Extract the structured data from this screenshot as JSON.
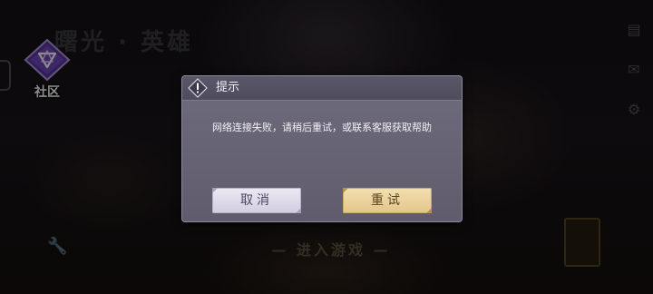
{
  "background": {
    "game_title": "曙光 · 英雄",
    "enter_game": "— 进入游戏 —"
  },
  "community": {
    "label": "社区",
    "icon": "triangle-emblem-icon"
  },
  "right_rail_icons": [
    "notice-icon",
    "mail-icon",
    "settings-icon"
  ],
  "dialog": {
    "title": "提示",
    "icon": "alert-diamond-icon",
    "message": "网络连接失败，请稍后重试，或联系客服获取帮助",
    "cancel_label": "取消",
    "retry_label": "重试"
  },
  "colors": {
    "dialog_bg": "#666374",
    "cancel_button": "#ddd8e8",
    "retry_button": "#eacf98",
    "community_emblem": "#6b3fb0"
  }
}
